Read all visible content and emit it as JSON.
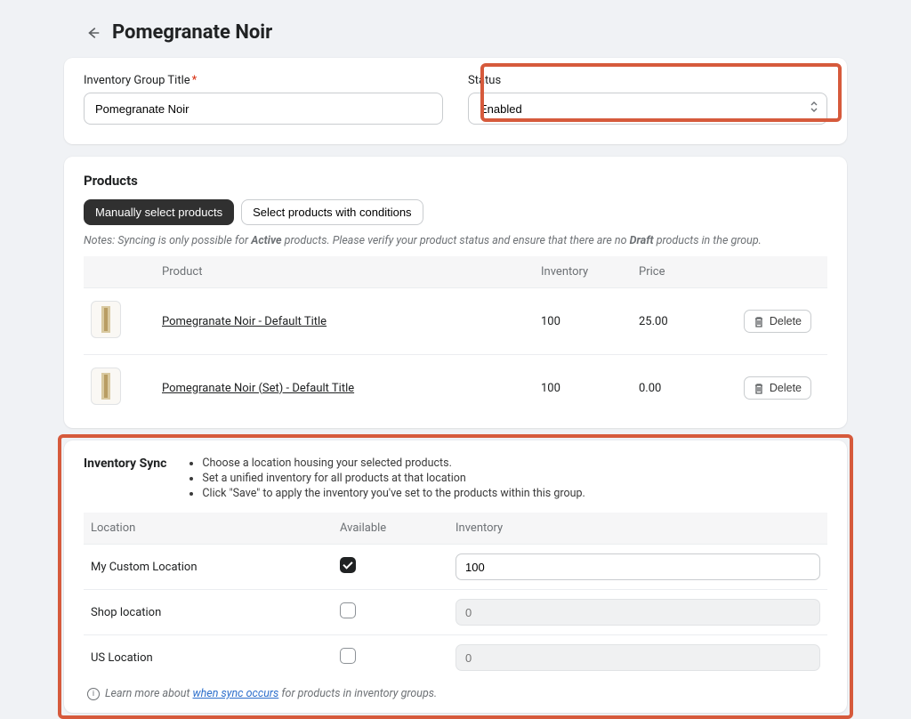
{
  "header": {
    "title": "Pomegranate Noir"
  },
  "card1": {
    "title_label": "Inventory Group Title",
    "title_value": "Pomegranate Noir",
    "status_label": "Status",
    "status_value": "Enabled"
  },
  "products": {
    "section_title": "Products",
    "tab_manual": "Manually select products",
    "tab_conditions": "Select products with conditions",
    "notes_prefix": "Notes: Syncing is only possible for ",
    "notes_active": "Active",
    "notes_middle": " products. Please verify your product status and ensure that there are no ",
    "notes_draft": "Draft",
    "notes_suffix": " products in the group.",
    "col_product": "Product",
    "col_inventory": "Inventory",
    "col_price": "Price",
    "delete_label": "Delete",
    "rows": [
      {
        "name": "Pomegranate Noir - Default Title",
        "inventory": "100",
        "price": "25.00"
      },
      {
        "name": "Pomegranate Noir (Set) - Default Title",
        "inventory": "100",
        "price": "0.00"
      }
    ]
  },
  "sync": {
    "title": "Inventory Sync",
    "bullets": [
      "Choose a location housing your selected products.",
      "Set a unified inventory for all products at that location",
      "Click \"Save\" to apply the inventory you've set to the products within this group."
    ],
    "col_location": "Location",
    "col_available": "Available",
    "col_inventory": "Inventory",
    "rows": [
      {
        "location": "My Custom Location",
        "available": true,
        "inventory": "100",
        "disabled": false
      },
      {
        "location": "Shop location",
        "available": false,
        "inventory": "0",
        "disabled": true
      },
      {
        "location": "US Location",
        "available": false,
        "inventory": "0",
        "disabled": true
      }
    ],
    "learn_prefix": "Learn more about ",
    "learn_link": "when sync occurs",
    "learn_suffix": " for products in inventory groups."
  }
}
